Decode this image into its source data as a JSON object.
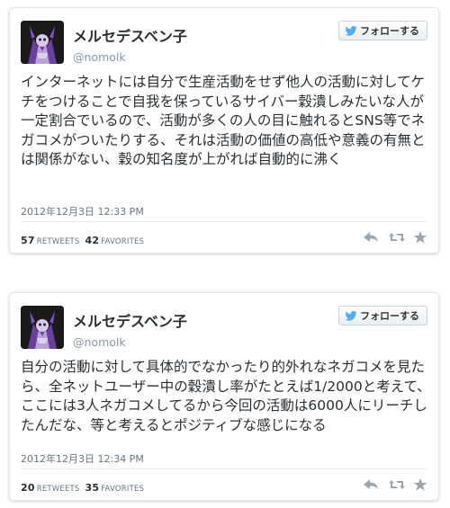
{
  "follow_label": "フォローする",
  "tweets": [
    {
      "display_name": "メルセデスベン子",
      "screen_name": "@nomolk",
      "text": "インターネットには自分で生産活動をせず他人の活動に対してケチをつけることで自我を保っているサイバー穀潰しみたいな人が一定割合でいるので、活動が多くの人の目に触れるとSNS等でネガコメがついたりする、それは活動の価値の高低や意義の有無とは関係がない、穀の知名度が上がれば自動的に沸く",
      "timestamp": "2012年12月3日 12:33 PM",
      "retweets_count": "57",
      "retweets_label": "RETWEETS",
      "favorites_count": "42",
      "favorites_label": "FAVORITES"
    },
    {
      "display_name": "メルセデスベン子",
      "screen_name": "@nomolk",
      "text": "自分の活動に対して具体的でなかったり的外れなネガコメを見たら、全ネットユーザー中の穀潰し率がたとえば1/2000と考えて、ここには3人ネガコメしてるから今回の活動は6000人にリーチしたんだな、等と考えるとポジティブな感じになる",
      "timestamp": "2012年12月3日 12:34 PM",
      "retweets_count": "20",
      "retweets_label": "RETWEETS",
      "favorites_count": "35",
      "favorites_label": "FAVORITES"
    }
  ],
  "colors": {
    "text": "#292f33",
    "muted": "#66757f",
    "twitter_blue": "#55acee",
    "action_gray": "#9aa6ae"
  },
  "icons": [
    "twitter-bird-icon",
    "reply-icon",
    "retweet-icon",
    "favorite-star-icon"
  ]
}
